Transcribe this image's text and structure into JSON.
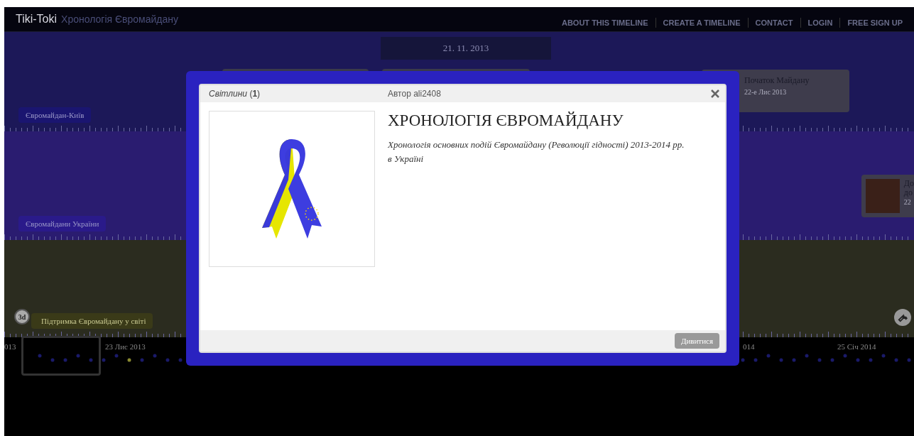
{
  "header": {
    "logo": "Tiki-Toki",
    "title": "Хронологія Євромайдану",
    "nav": [
      "ABOUT THIS TIMELINE",
      "CREATE A TIMELINE",
      "CONTACT",
      "LOGIN",
      "FREE SIGN UP"
    ]
  },
  "date_pill": "21. 11. 2013",
  "tracks": [
    {
      "label": "Євромайдан-Київ"
    },
    {
      "label": "Євромайдани України"
    },
    {
      "label": "Підтримка Євромайдану у світі"
    }
  ],
  "cards": [
    {
      "title": "Початок Майдану",
      "date": "22-е Лис 2013"
    },
    {
      "title": "До",
      "subtitle": "до",
      "date": "22"
    }
  ],
  "view_button": "3d",
  "timeline": {
    "labels": [
      "013",
      "23 Лис 2013",
      "014",
      "25 Січ 2014"
    ]
  },
  "modal": {
    "gallery": "*Світлини* (**1**)",
    "author": "Автор ali2408",
    "title": "ХРОНОЛОГІЯ ЄВРОМАЙДАНУ",
    "description": "Хронологія основних подій Євромайдану (Революції гідності) 2013-2014 рр. в Україні",
    "button": "Дивитися"
  }
}
